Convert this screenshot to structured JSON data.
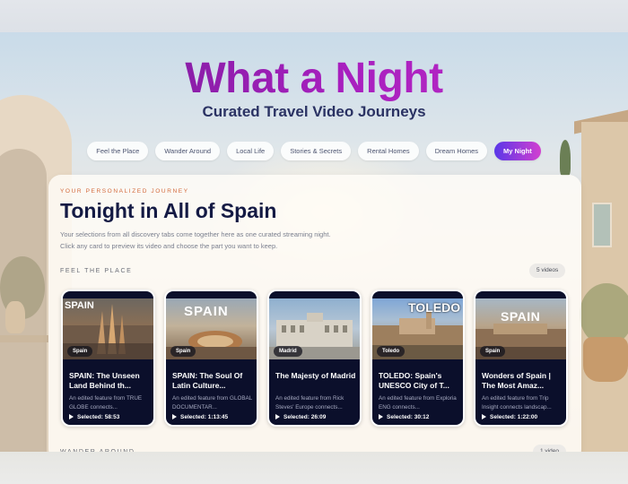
{
  "header": {
    "title": "What a Night",
    "subtitle": "Curated Travel Video Journeys"
  },
  "tabs": [
    {
      "label": "Feel the Place",
      "active": false
    },
    {
      "label": "Wander Around",
      "active": false
    },
    {
      "label": "Local Life",
      "active": false
    },
    {
      "label": "Stories & Secrets",
      "active": false
    },
    {
      "label": "Rental Homes",
      "active": false
    },
    {
      "label": "Dream Homes",
      "active": false
    },
    {
      "label": "My Night",
      "active": true
    }
  ],
  "panel": {
    "eyebrow": "YOUR PERSONALIZED JOURNEY",
    "heading": "Tonight in All of Spain",
    "desc_line1": "Your selections from all discovery tabs come together here as one curated streaming night.",
    "desc_line2": "Click any card to preview its video and choose the part you want to keep."
  },
  "sections": [
    {
      "label": "FEEL THE PLACE",
      "count": "5 videos",
      "cards": [
        {
          "thumb_text": "SPAIN",
          "location": "Spain",
          "title": "SPAIN: The Unseen Land Behind th...",
          "desc": "An edited feature from TRUE GLOBE connects...",
          "selected": "Selected: 58:53"
        },
        {
          "thumb_text": "SPAIN",
          "location": "Spain",
          "title": "SPAIN: The Soul Of Latin Culture...",
          "desc": "An edited feature from GLOBAL DOCUMENTAR...",
          "selected": "Selected: 1:13:45"
        },
        {
          "thumb_text": "",
          "location": "Madrid",
          "title": "The Majesty of Madrid",
          "desc": "An edited feature from Rick Steves' Europe connects...",
          "selected": "Selected: 26:09"
        },
        {
          "thumb_text": "TOLEDO",
          "location": "Toledo",
          "title": "TOLEDO: Spain's UNESCO City of T...",
          "desc": "An edited feature from Exploria ENG connects...",
          "selected": "Selected: 30:12"
        },
        {
          "thumb_text": "SPAIN",
          "location": "Spain",
          "title": "Wonders of Spain | The Most Amaz...",
          "desc": "An edited feature from Trip Insight connects landscap...",
          "selected": "Selected: 1:22:00"
        }
      ]
    },
    {
      "label": "WANDER AROUND",
      "count": "1 video"
    }
  ],
  "colors": {
    "accent_start": "#5a38e8",
    "accent_end": "#d23fd0",
    "title_purple": "#a81fbf",
    "eyebrow": "#d36a3c",
    "card_bg": "#0b0f2b"
  }
}
